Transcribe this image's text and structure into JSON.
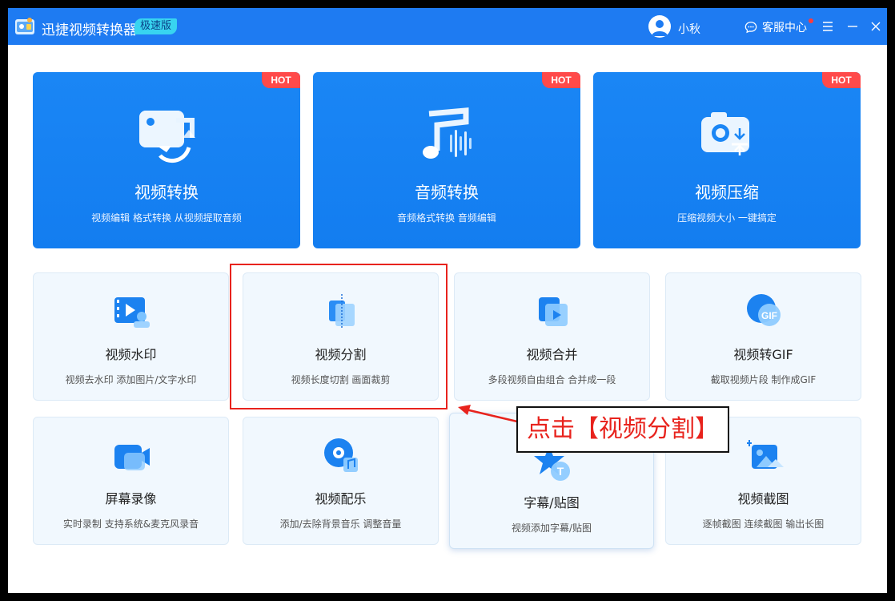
{
  "titlebar": {
    "app_title": "迅捷视频转换器",
    "edition_badge": "极速版",
    "user_name": "小秋",
    "support_label": "客服中心"
  },
  "big_cards": [
    {
      "id": "video-convert",
      "title": "视频转换",
      "subtitle": "视频编辑 格式转换 从视频提取音频",
      "badge": "HOT",
      "icon": "video-convert-icon"
    },
    {
      "id": "audio-convert",
      "title": "音频转换",
      "subtitle": "音频格式转换 音频编辑",
      "badge": "HOT",
      "icon": "music-note-icon"
    },
    {
      "id": "video-compress",
      "title": "视频压缩",
      "subtitle": "压缩视频大小 一键搞定",
      "badge": "HOT",
      "icon": "camera-compress-icon"
    }
  ],
  "small_cards": [
    {
      "id": "watermark",
      "title": "视频水印",
      "subtitle": "视频去水印 添加图片/文字水印",
      "icon": "film-watermark-icon"
    },
    {
      "id": "split",
      "title": "视频分割",
      "subtitle": "视频长度切割 画面裁剪",
      "icon": "split-icon"
    },
    {
      "id": "merge",
      "title": "视频合并",
      "subtitle": "多段视频自由组合 合并成一段",
      "icon": "merge-play-icon"
    },
    {
      "id": "gif",
      "title": "视频转GIF",
      "subtitle": "截取视频片段 制作成GIF",
      "icon": "gif-icon",
      "icon_text": "GIF"
    },
    {
      "id": "record",
      "title": "屏幕录像",
      "subtitle": "实时录制 支持系统&麦克风录音",
      "icon": "camcorder-icon"
    },
    {
      "id": "music",
      "title": "视频配乐",
      "subtitle": "添加/去除背景音乐 调整音量",
      "icon": "disc-music-icon"
    },
    {
      "id": "subtitle",
      "title": "字幕/贴图",
      "subtitle": "视频添加字幕/贴图",
      "icon": "star-text-icon",
      "icon_text": "T"
    },
    {
      "id": "screenshot",
      "title": "视频截图",
      "subtitle": "逐帧截图 连续截图 输出长图",
      "icon": "image-capture-icon"
    }
  ],
  "annotation": {
    "callout_text": "点击【视频分割】",
    "color": "#e8231d"
  },
  "colors": {
    "brand_blue": "#1e7bf2",
    "card_blue": "#1583f3",
    "hot_red": "#ff4a4a",
    "small_card_bg": "#f1f8fe"
  }
}
